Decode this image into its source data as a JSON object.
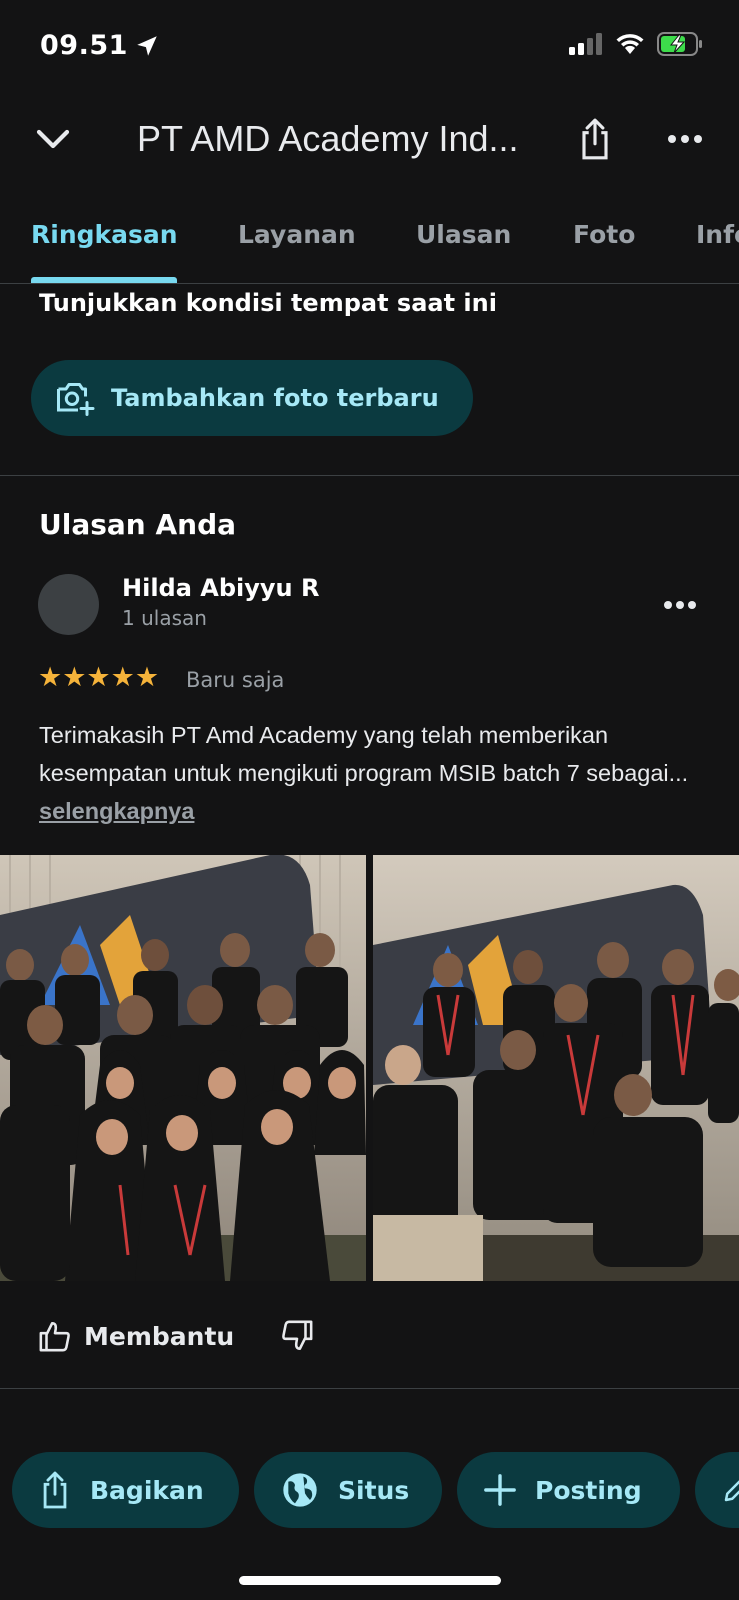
{
  "status_bar": {
    "time": "09.51"
  },
  "header": {
    "title": "PT AMD Academy Ind..."
  },
  "tabs": [
    {
      "label": "Ringkasan",
      "active": true
    },
    {
      "label": "Layanan",
      "active": false
    },
    {
      "label": "Ulasan",
      "active": false
    },
    {
      "label": "Foto",
      "active": false
    },
    {
      "label": "Info",
      "active": false
    }
  ],
  "current_condition": {
    "prompt": "Tunjukkan kondisi tempat saat ini",
    "add_photo_label": "Tambahkan foto terbaru"
  },
  "review": {
    "heading": "Ulasan Anda",
    "reviewer_name": "Hilda Abiyyu R",
    "reviewer_count": "1 ulasan",
    "rating": 5,
    "stars": "★★★★★",
    "time": "Baru saja",
    "text": "Terimakasih PT Amd Academy yang telah memberikan kesempatan untuk mengikuti program MSIB batch 7 sebagai...",
    "see_more": "selengkapnya",
    "helpful_label": "Membantu"
  },
  "actions": [
    {
      "label": "Bagikan",
      "icon": "share-icon"
    },
    {
      "label": "Situs",
      "icon": "globe-icon"
    },
    {
      "label": "Posting",
      "icon": "plus-icon"
    }
  ],
  "colors": {
    "background": "#131314",
    "accent": "#78d9f0",
    "chip_bg": "#0b3a40",
    "chip_text": "#a6e8f6",
    "star": "#f5b33a"
  }
}
